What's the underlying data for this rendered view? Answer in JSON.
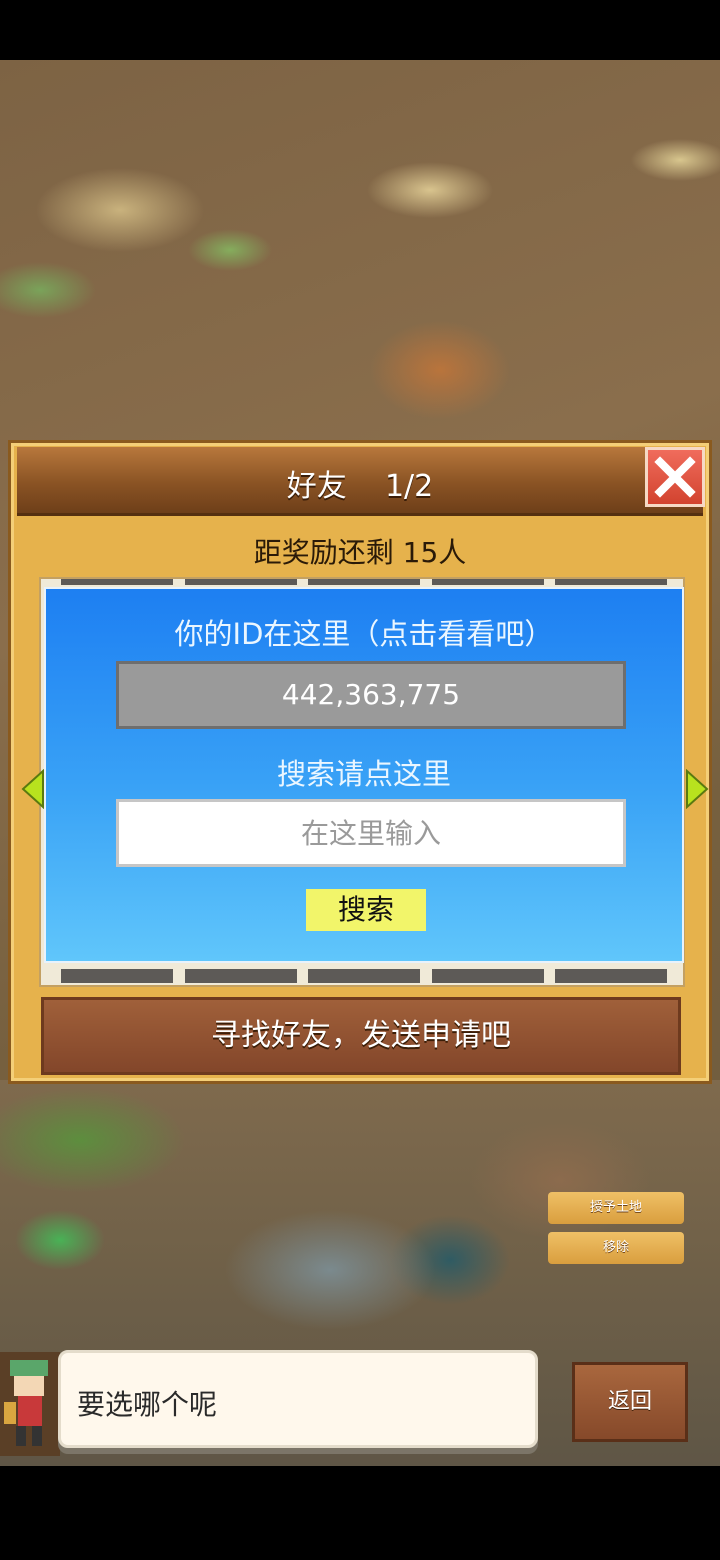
{
  "dialog": {
    "title": "好友",
    "page": "1/2",
    "reward_text": "距奖励还剩 15人",
    "id_label": "你的ID在这里（点击看看吧）",
    "id_value": "442,363,775",
    "search_label": "搜索请点这里",
    "search_placeholder": "在这里输入",
    "search_button": "搜索",
    "find_button": "寻找好友，发送申请吧"
  },
  "side_buttons": {
    "grant_land": "授予土地",
    "remove": "移除"
  },
  "speech": {
    "text": "要选哪个呢",
    "back_button": "返回"
  },
  "colors": {
    "panel_blue": "#1d7ff2",
    "frame_gold": "#e6b24c",
    "close_red": "#d2432f",
    "search_button_yellow": "#f2f56a"
  }
}
